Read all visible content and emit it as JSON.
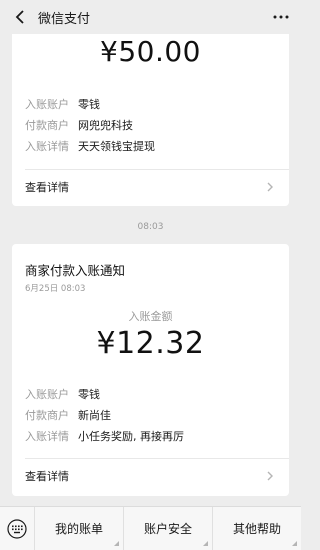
{
  "header": {
    "title": "微信支付",
    "back_icon": "chevron-left-icon",
    "more_icon": "ellipsis-icon"
  },
  "card1": {
    "amount": "¥50.00",
    "rows": [
      {
        "key": "入账账户",
        "value": "零钱"
      },
      {
        "key": "付款商户",
        "value": "网兜兜科技"
      },
      {
        "key": "入账详情",
        "value": "天天领钱宝提现"
      }
    ],
    "detail_label": "查看详情"
  },
  "timestamp": "08:03",
  "card2": {
    "title": "商家付款入账通知",
    "date": "6月25日  08:03",
    "amount_label": "入账金额",
    "amount": "¥12.32",
    "rows": [
      {
        "key": "入账账户",
        "value": "零钱"
      },
      {
        "key": "付款商户",
        "value": "新尚佳"
      },
      {
        "key": "入账详情",
        "value": "小任务奖励, 再接再厉"
      }
    ],
    "detail_label": "查看详情"
  },
  "bottom_bar": {
    "keyboard_icon": "keyboard-icon",
    "tabs": [
      {
        "label": "我的账单"
      },
      {
        "label": "账户安全"
      },
      {
        "label": "其他帮助"
      }
    ]
  },
  "colors": {
    "background": "#ededed",
    "card": "#ffffff",
    "muted_text": "#9a9a9a"
  }
}
